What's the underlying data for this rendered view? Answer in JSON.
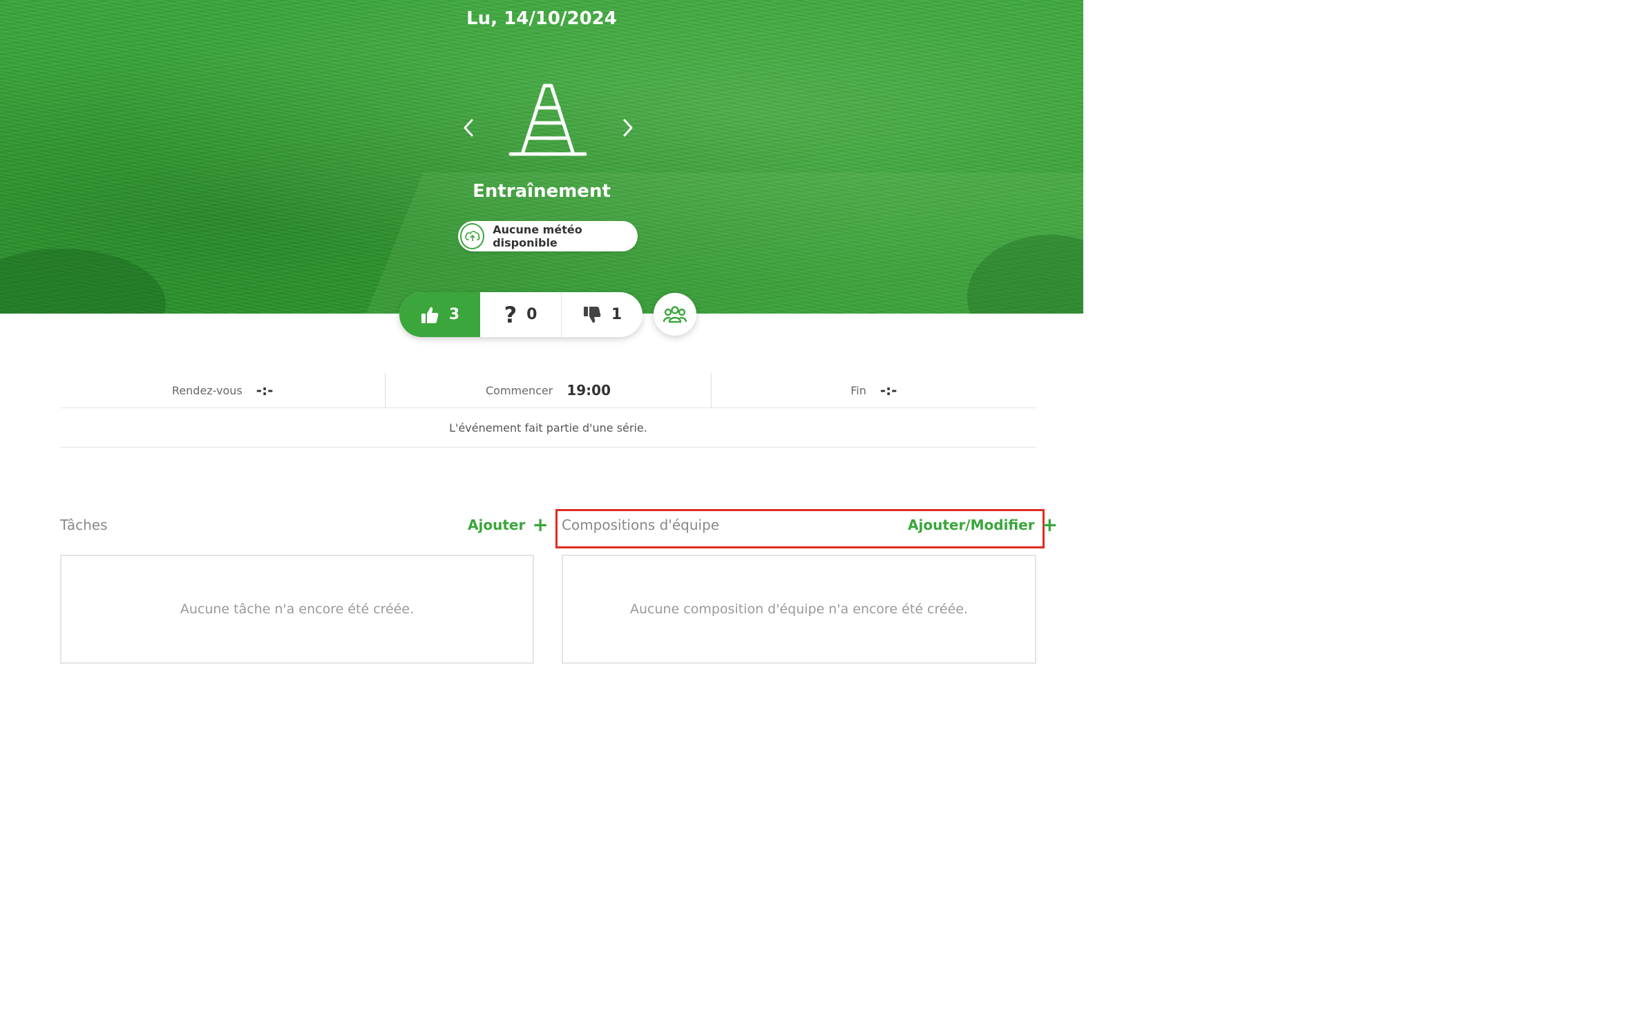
{
  "header": {
    "date": "Lu, 14/10/2024",
    "event_type": "Entraînement",
    "weather_text": "Aucune météo disponible",
    "accent_color": "#3aa63b"
  },
  "attendance": {
    "yes_count": "3",
    "maybe_symbol": "?",
    "maybe_count": "0",
    "no_count": "1"
  },
  "times": {
    "meeting_label": "Rendez-vous",
    "meeting_value": "-:-",
    "start_label": "Commencer",
    "start_value": "19:00",
    "end_label": "Fin",
    "end_value": "-:-"
  },
  "series_note": "L'événement fait partie d'une série.",
  "tasks": {
    "title": "Tâches",
    "action_label": "Ajouter",
    "action_icon": "+",
    "empty_text": "Aucune tâche n'a encore été créée."
  },
  "lineups": {
    "title": "Compositions d'équipe",
    "action_label": "Ajouter/Modifier",
    "action_icon": "+",
    "empty_text": "Aucune composition d'équipe n'a encore été créée.",
    "highlight_color": "#e02b1f"
  },
  "icons": {
    "prev": "chevron-left-icon",
    "next": "chevron-right-icon",
    "event": "training-cone-icon",
    "weather": "cloud-upload-icon",
    "yes": "thumbs-up-icon",
    "no": "thumbs-down-icon",
    "squad": "group-icon"
  }
}
